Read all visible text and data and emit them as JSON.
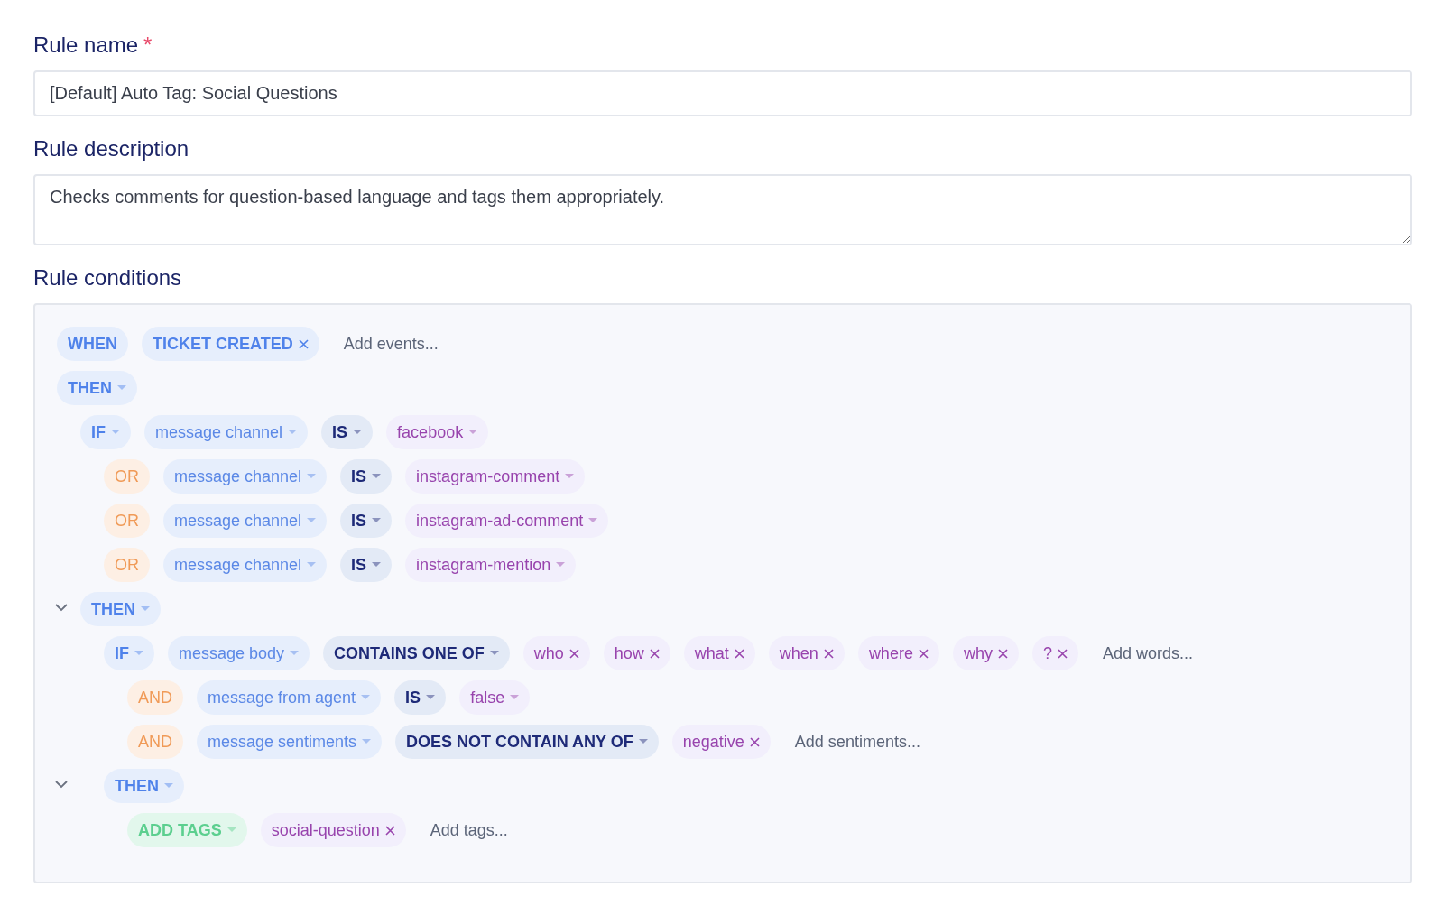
{
  "fields": [
    {
      "kind": "input",
      "label": "Rule name",
      "required_mark": "*",
      "value": "[Default] Auto Tag: Social Questions"
    },
    {
      "kind": "textarea",
      "label": "Rule description",
      "value": "Checks comments for question-based language and tags them appropriately."
    }
  ],
  "conditions": {
    "label": "Rule conditions",
    "rows": [
      {
        "chips": [
          {
            "kind": "keyword",
            "text": "WHEN"
          },
          {
            "kind": "keyword",
            "text": "TICKET CREATED",
            "removable": true
          },
          {
            "kind": "placeholder",
            "text": "Add events..."
          }
        ]
      },
      {
        "chips": [
          {
            "kind": "keyword",
            "text": "THEN",
            "caret": true
          }
        ],
        "children": [
          {
            "chips": [
              {
                "kind": "keyword",
                "text": "IF",
                "caret": true
              },
              {
                "kind": "operand",
                "text": "message channel",
                "caret": true
              },
              {
                "kind": "operator",
                "text": "IS",
                "caret": true
              },
              {
                "kind": "value",
                "text": "facebook",
                "caret": true
              }
            ],
            "children": [
              {
                "chips": [
                  {
                    "kind": "logic",
                    "text": "OR"
                  },
                  {
                    "kind": "operand",
                    "text": "message channel",
                    "caret": true
                  },
                  {
                    "kind": "operator",
                    "text": "IS",
                    "caret": true
                  },
                  {
                    "kind": "value",
                    "text": "instagram-comment",
                    "caret": true
                  }
                ]
              },
              {
                "chips": [
                  {
                    "kind": "logic",
                    "text": "OR"
                  },
                  {
                    "kind": "operand",
                    "text": "message channel",
                    "caret": true
                  },
                  {
                    "kind": "operator",
                    "text": "IS",
                    "caret": true
                  },
                  {
                    "kind": "value",
                    "text": "instagram-ad-comment",
                    "caret": true
                  }
                ]
              },
              {
                "chips": [
                  {
                    "kind": "logic",
                    "text": "OR"
                  },
                  {
                    "kind": "operand",
                    "text": "message channel",
                    "caret": true
                  },
                  {
                    "kind": "operator",
                    "text": "IS",
                    "caret": true
                  },
                  {
                    "kind": "value",
                    "text": "instagram-mention",
                    "caret": true
                  }
                ]
              }
            ]
          },
          {
            "expanded": true,
            "chips": [
              {
                "kind": "keyword",
                "text": "THEN",
                "caret": true
              }
            ],
            "children": [
              {
                "chips": [
                  {
                    "kind": "keyword",
                    "text": "IF",
                    "caret": true
                  },
                  {
                    "kind": "operand",
                    "text": "message body",
                    "caret": true
                  },
                  {
                    "kind": "operator",
                    "text": "CONTAINS ONE OF",
                    "caret": true
                  },
                  {
                    "kind": "value",
                    "text": "who",
                    "removable": true
                  },
                  {
                    "kind": "value",
                    "text": "how",
                    "removable": true
                  },
                  {
                    "kind": "value",
                    "text": "what",
                    "removable": true
                  },
                  {
                    "kind": "value",
                    "text": "when",
                    "removable": true
                  },
                  {
                    "kind": "value",
                    "text": "where",
                    "removable": true
                  },
                  {
                    "kind": "value",
                    "text": "why",
                    "removable": true
                  },
                  {
                    "kind": "value",
                    "text": "?",
                    "removable": true
                  },
                  {
                    "kind": "placeholder",
                    "text": "Add words..."
                  }
                ],
                "children": [
                  {
                    "chips": [
                      {
                        "kind": "logic",
                        "text": "AND"
                      },
                      {
                        "kind": "operand",
                        "text": "message from agent",
                        "caret": true
                      },
                      {
                        "kind": "operator",
                        "text": "IS",
                        "caret": true
                      },
                      {
                        "kind": "value",
                        "text": "false",
                        "caret": true
                      }
                    ]
                  },
                  {
                    "chips": [
                      {
                        "kind": "logic",
                        "text": "AND"
                      },
                      {
                        "kind": "operand",
                        "text": "message sentiments",
                        "caret": true
                      },
                      {
                        "kind": "operator",
                        "text": "DOES NOT CONTAIN ANY OF",
                        "caret": true
                      },
                      {
                        "kind": "value",
                        "text": "negative",
                        "removable": true
                      },
                      {
                        "kind": "placeholder",
                        "text": "Add sentiments..."
                      }
                    ]
                  }
                ]
              },
              {
                "expanded": true,
                "chips": [
                  {
                    "kind": "keyword",
                    "text": "THEN",
                    "caret": true
                  }
                ],
                "children": [
                  {
                    "chips": [
                      {
                        "kind": "action",
                        "text": "ADD TAGS",
                        "caret": true
                      },
                      {
                        "kind": "value",
                        "text": "social-question",
                        "removable": true
                      },
                      {
                        "kind": "placeholder",
                        "text": "Add tags..."
                      }
                    ]
                  }
                ]
              }
            ]
          }
        ]
      }
    ]
  }
}
